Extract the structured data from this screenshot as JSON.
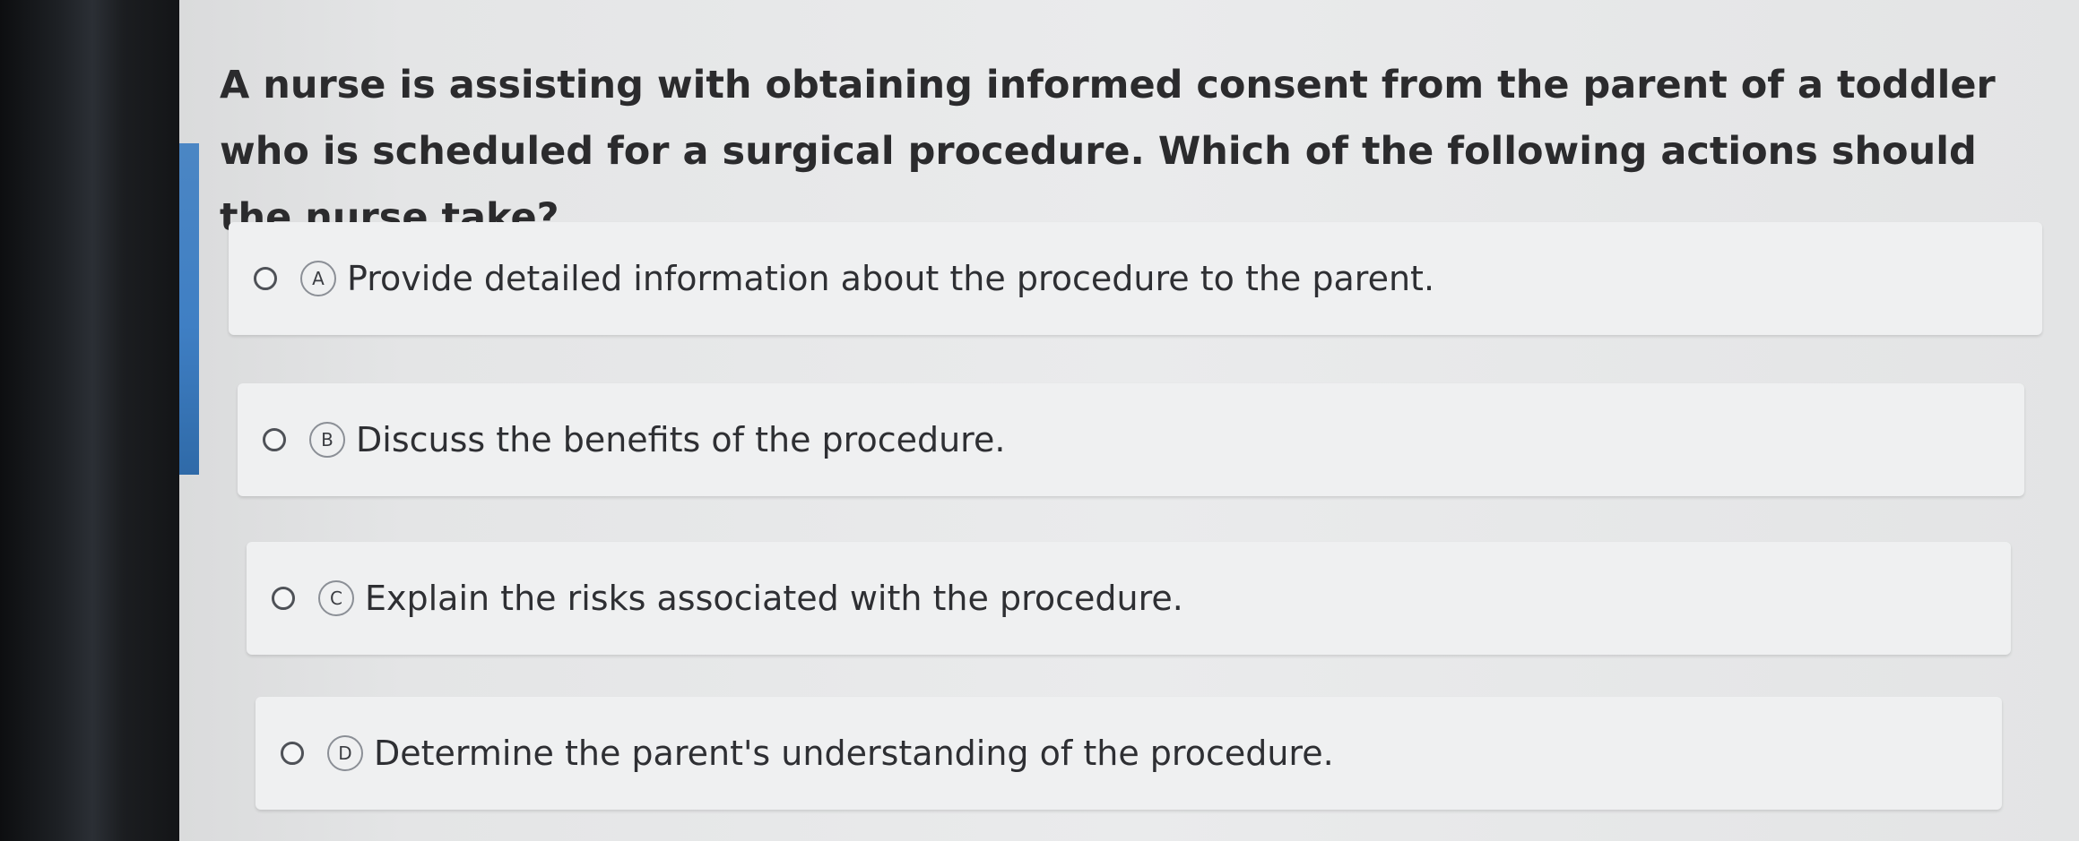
{
  "question": {
    "text": "A nurse is assisting with obtaining informed consent from the parent of a toddler who is scheduled for a surgical procedure. Which of the following actions should the nurse take?"
  },
  "options": [
    {
      "letter": "A",
      "text": "Provide detailed information about the procedure to the parent."
    },
    {
      "letter": "B",
      "text": "Discuss the benefits of the procedure."
    },
    {
      "letter": "C",
      "text": "Explain the risks associated with the procedure."
    },
    {
      "letter": "D",
      "text": "Determine the parent's understanding of the procedure."
    }
  ],
  "colors": {
    "accent": "#3f7fc4",
    "text": "#2b2b2d",
    "option_bg": "#eff0f1"
  }
}
